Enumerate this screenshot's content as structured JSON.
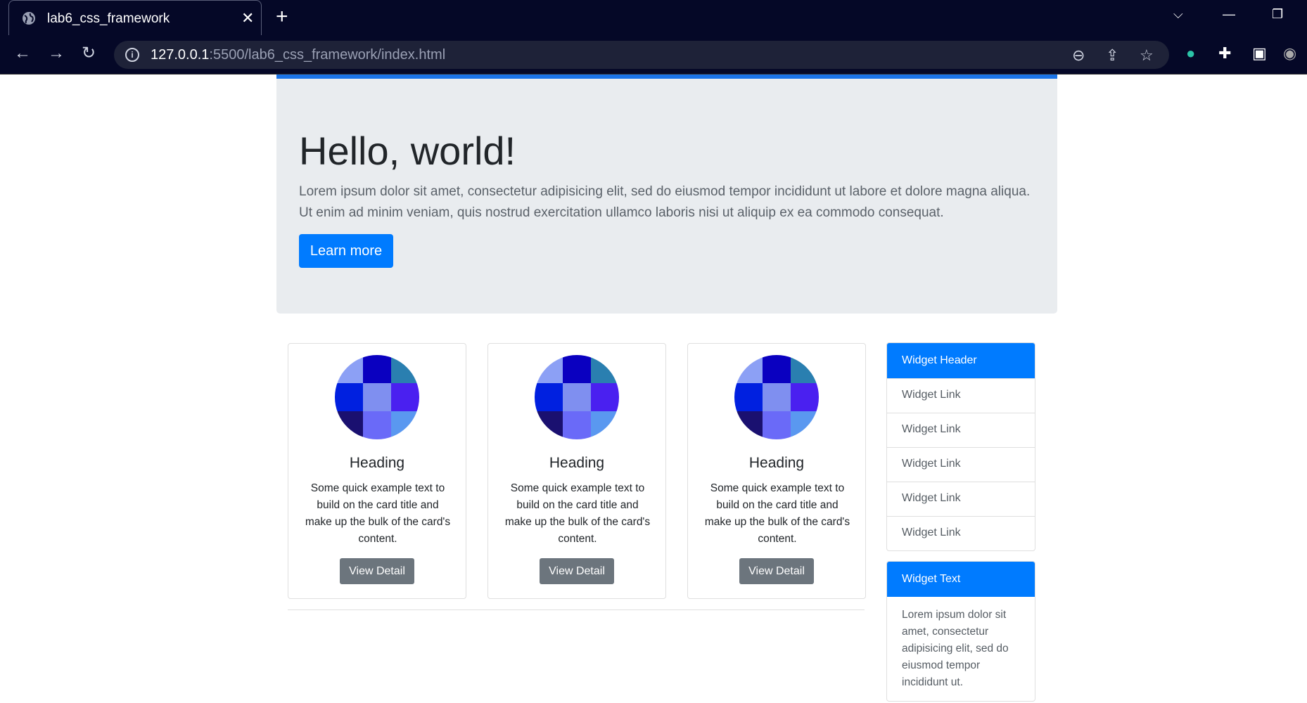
{
  "browser": {
    "tab_title": "lab6_css_framework",
    "url_host": "127.0.0.1",
    "url_path": ":5500/lab6_css_framework/index.html"
  },
  "jumbotron": {
    "title": "Hello, world!",
    "text": "Lorem ipsum dolor sit amet, consectetur adipisicing elit, sed do eiusmod tempor incididunt ut labore et dolore magna aliqua. Ut enim ad minim veniam, quis nostrud exercitation ullamco laboris nisi ut aliquip ex ea commodo consequat.",
    "button_label": "Learn more"
  },
  "cards": [
    {
      "heading": "Heading",
      "text": "Some quick example text to build on the card title and make up the bulk of the card's content.",
      "button_label": "View Detail"
    },
    {
      "heading": "Heading",
      "text": "Some quick example text to build on the card title and make up the bulk of the card's content.",
      "button_label": "View Detail"
    },
    {
      "heading": "Heading",
      "text": "Some quick example text to build on the card title and make up the bulk of the card's content.",
      "button_label": "View Detail"
    }
  ],
  "avatar_colors": [
    "#8ca0f5",
    "#0a00c0",
    "#2a7fb0",
    "#0020e0",
    "#7f8ff0",
    "#4a20f0",
    "#1a1070",
    "#6a6af8",
    "#5a98f0"
  ],
  "widget_links": {
    "header": "Widget Header",
    "links": [
      "Widget Link",
      "Widget Link",
      "Widget Link",
      "Widget Link",
      "Widget Link"
    ]
  },
  "widget_text": {
    "header": "Widget Text",
    "body": "Lorem ipsum dolor sit amet, consectetur adipisicing elit, sed do eiusmod tempor incididunt ut."
  },
  "colors": {
    "primary": "#007bff",
    "secondary": "#6c757d",
    "jumbotron_bg": "#e9ecef"
  }
}
